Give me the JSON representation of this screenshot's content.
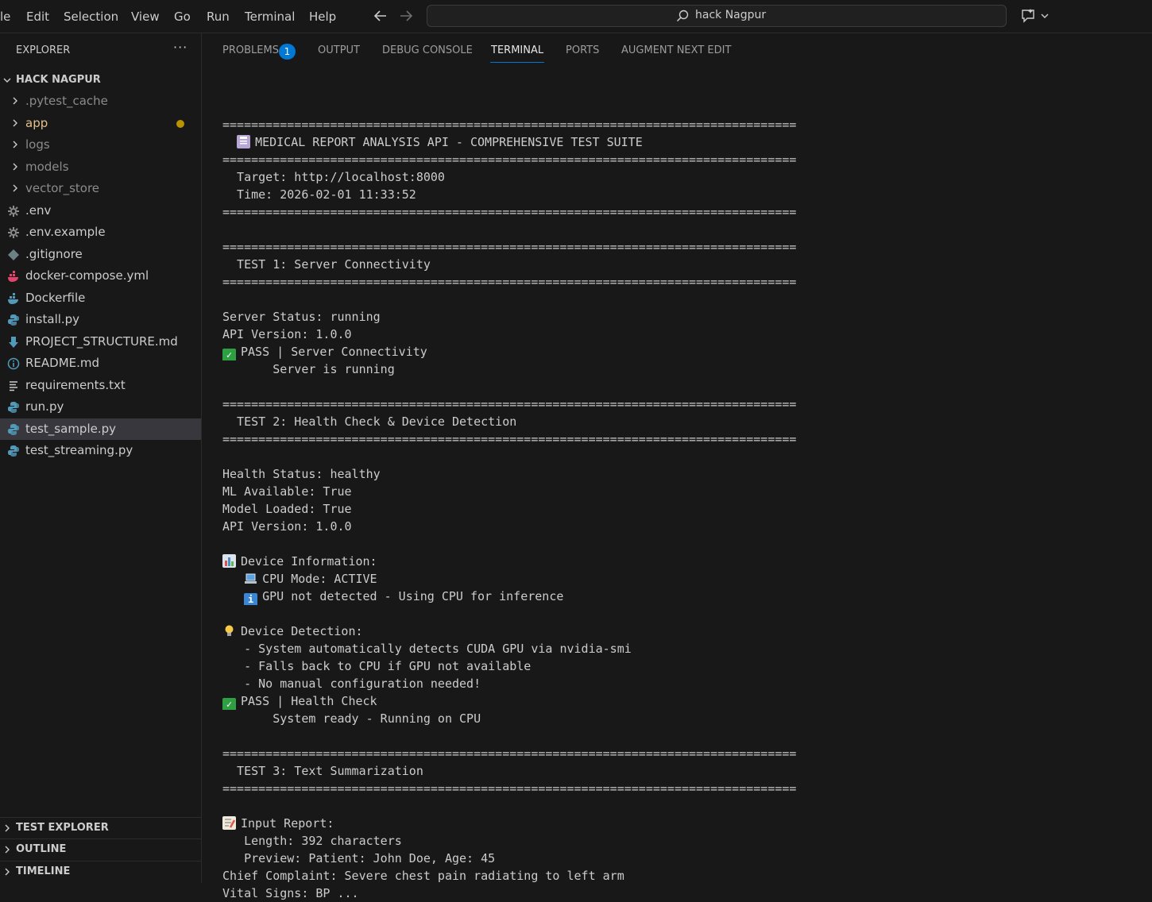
{
  "menu": [
    "le",
    "Edit",
    "Selection",
    "View",
    "Go",
    "Run",
    "Terminal",
    "Help"
  ],
  "search": {
    "text": "hack Nagpur"
  },
  "sidebar": {
    "header": "EXPLORER",
    "more": "···",
    "workspace": "HACK NAGPUR",
    "items": [
      {
        "label": ".pytest_cache",
        "kind": "folder",
        "style": "dim"
      },
      {
        "label": "app",
        "kind": "folder",
        "style": "modified"
      },
      {
        "label": "logs",
        "kind": "folder",
        "style": "dim"
      },
      {
        "label": "models",
        "kind": "folder",
        "style": "dim"
      },
      {
        "label": "vector_store",
        "kind": "folder",
        "style": "dim"
      },
      {
        "label": ".env",
        "kind": "gear-icon"
      },
      {
        "label": ".env.example",
        "kind": "gear-icon"
      },
      {
        "label": ".gitignore",
        "kind": "git-icon"
      },
      {
        "label": "docker-compose.yml",
        "kind": "docker-compose-icon"
      },
      {
        "label": "Dockerfile",
        "kind": "docker-icon"
      },
      {
        "label": "install.py",
        "kind": "python-icon"
      },
      {
        "label": "PROJECT_STRUCTURE.md",
        "kind": "markdown-icon"
      },
      {
        "label": "README.md",
        "kind": "info-icon"
      },
      {
        "label": "requirements.txt",
        "kind": "text-icon"
      },
      {
        "label": "run.py",
        "kind": "python-icon"
      },
      {
        "label": "test_sample.py",
        "kind": "python-icon",
        "selected": true
      },
      {
        "label": "test_streaming.py",
        "kind": "python-icon"
      }
    ],
    "sections": [
      "TEST EXPLORER",
      "OUTLINE",
      "TIMELINE"
    ]
  },
  "panel": {
    "tabs": [
      "PROBLEMS",
      "OUTPUT",
      "DEBUG CONSOLE",
      "TERMINAL",
      "PORTS",
      "AUGMENT NEXT EDIT"
    ],
    "active_tab": "TERMINAL",
    "problems_count": "1"
  },
  "colors": {
    "accent": "#0078d4",
    "pass": "#2ea043",
    "modified": "#e2c08d",
    "python": "#519aba",
    "docker": "#e37933"
  },
  "terminal": {
    "lines": [
      {
        "text": ""
      },
      {
        "text": "================================================================================"
      },
      {
        "icon": "clipboard-icon",
        "text": "MEDICAL REPORT ANALYSIS API - COMPREHENSIVE TEST SUITE",
        "indent": "  "
      },
      {
        "text": "================================================================================"
      },
      {
        "text": "  Target: http://localhost:8000"
      },
      {
        "text": "  Time: 2026-02-01 11:33:52"
      },
      {
        "text": "================================================================================"
      },
      {
        "text": ""
      },
      {
        "text": "================================================================================"
      },
      {
        "text": "  TEST 1: Server Connectivity"
      },
      {
        "text": "================================================================================"
      },
      {
        "text": ""
      },
      {
        "text": "Server Status: running"
      },
      {
        "text": "API Version: 1.0.0"
      },
      {
        "icon": "check-icon",
        "text": "PASS | Server Connectivity"
      },
      {
        "text": "       Server is running"
      },
      {
        "text": ""
      },
      {
        "text": "================================================================================"
      },
      {
        "text": "  TEST 2: Health Check & Device Detection"
      },
      {
        "text": "================================================================================"
      },
      {
        "text": ""
      },
      {
        "text": "Health Status: healthy"
      },
      {
        "text": "ML Available: True"
      },
      {
        "text": "Model Loaded: True"
      },
      {
        "text": "API Version: 1.0.0"
      },
      {
        "text": ""
      },
      {
        "icon": "chart-icon",
        "text": "Device Information:"
      },
      {
        "icon": "laptop-icon",
        "text": "CPU Mode: ACTIVE",
        "indent": "   "
      },
      {
        "icon": "info-icon",
        "text": "GPU not detected - Using CPU for inference",
        "indent": "   "
      },
      {
        "text": ""
      },
      {
        "icon": "bulb-icon",
        "text": "Device Detection:"
      },
      {
        "text": "   - System automatically detects CUDA GPU via nvidia-smi"
      },
      {
        "text": "   - Falls back to CPU if GPU not available"
      },
      {
        "text": "   - No manual configuration needed!"
      },
      {
        "icon": "check-icon",
        "text": "PASS | Health Check"
      },
      {
        "text": "       System ready - Running on CPU"
      },
      {
        "text": ""
      },
      {
        "text": "================================================================================"
      },
      {
        "text": "  TEST 3: Text Summarization"
      },
      {
        "text": "================================================================================"
      },
      {
        "text": ""
      },
      {
        "icon": "memo-icon",
        "text": "Input Report:"
      },
      {
        "text": "   Length: 392 characters"
      },
      {
        "text": "   Preview: Patient: John Doe, Age: 45"
      },
      {
        "text": "Chief Complaint: Severe chest pain radiating to left arm"
      },
      {
        "text": "Vital Signs: BP ..."
      }
    ]
  }
}
